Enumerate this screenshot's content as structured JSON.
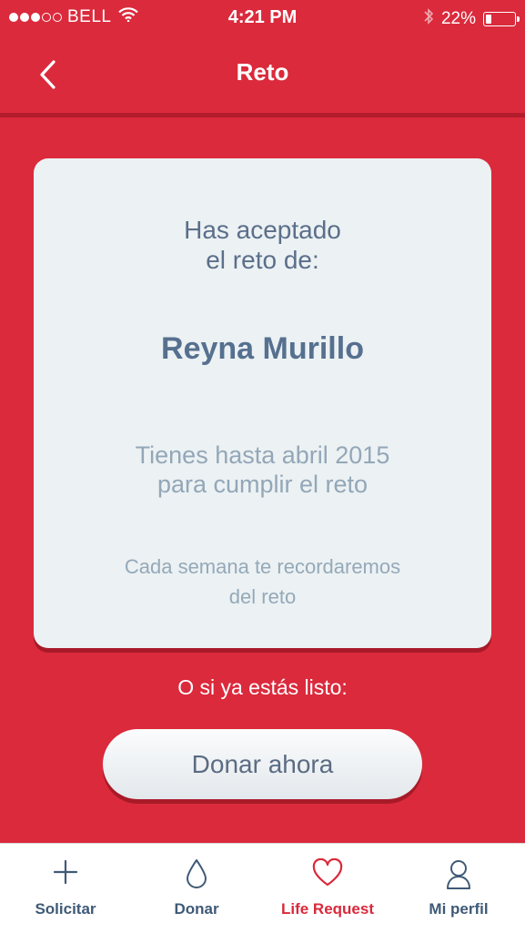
{
  "status_bar": {
    "carrier": "BELL",
    "time": "4:21 PM",
    "battery_percent": "22%",
    "battery_level": 0.22
  },
  "nav": {
    "title": "Reto"
  },
  "card": {
    "intro_line1": "Has aceptado",
    "intro_line2": "el reto de:",
    "challenger_name": "Reyna Murillo",
    "deadline_line1": "Tienes hasta abril 2015",
    "deadline_line2": "para cumplir el reto",
    "reminder_line1": "Cada semana te recordaremos",
    "reminder_line2": "del reto"
  },
  "ready_text": "O si ya estás listo:",
  "donate_button": "Donar ahora",
  "tabs": [
    {
      "label": "Solicitar",
      "icon": "plus-icon"
    },
    {
      "label": "Donar",
      "icon": "drop-icon"
    },
    {
      "label": "Life Request",
      "icon": "heart-icon",
      "active": true
    },
    {
      "label": "Mi perfil",
      "icon": "person-icon"
    }
  ],
  "colors": {
    "background": "#db2a3c",
    "card": "#ecf1f3",
    "active_tab": "#d9293b",
    "tab_text": "#3f5a77"
  }
}
